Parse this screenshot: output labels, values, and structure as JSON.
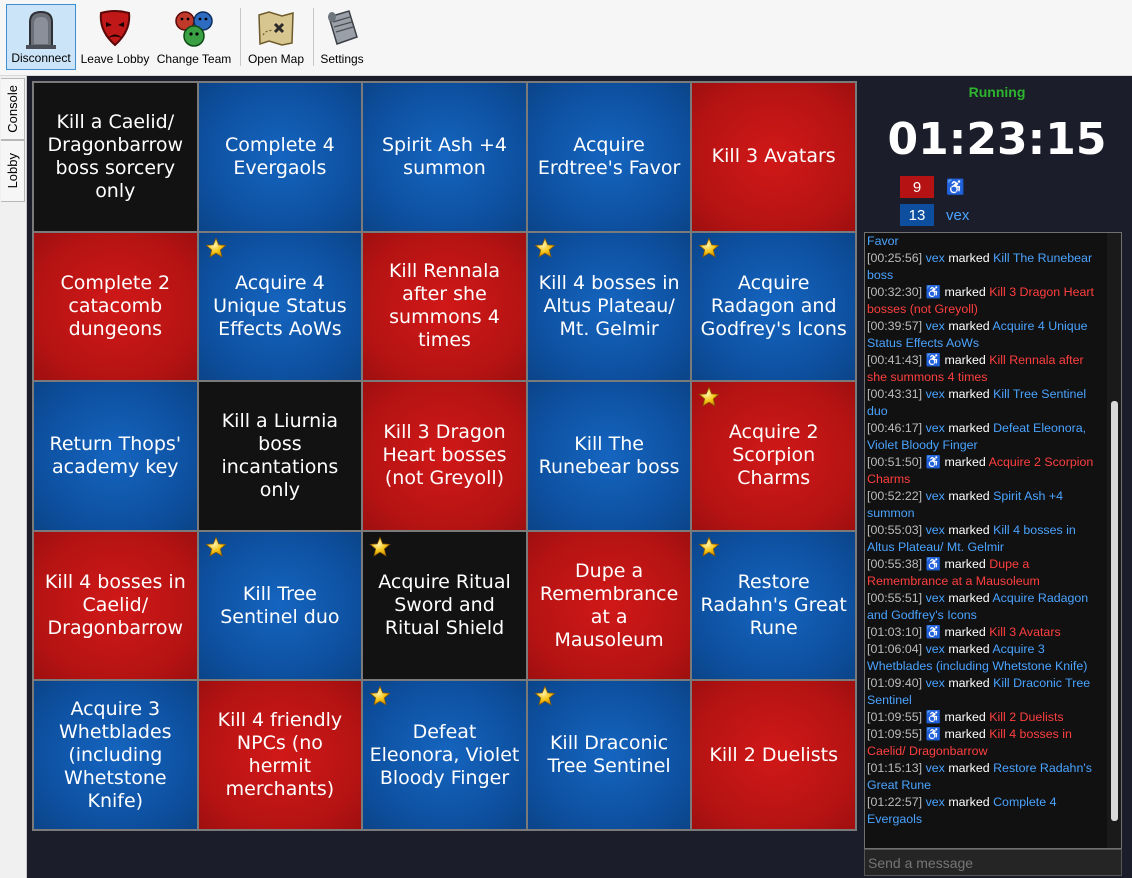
{
  "toolbar": {
    "disconnect": "Disconnect",
    "leave_lobby": "Leave Lobby",
    "change_team": "Change Team",
    "open_map": "Open Map",
    "settings": "Settings"
  },
  "side_tabs": {
    "console": "Console",
    "lobby": "Lobby"
  },
  "colors": {
    "blue_team": "#0d4f9e",
    "red_team": "#b51313",
    "unmarked": "#121212",
    "running": "#2db52d"
  },
  "board": {
    "cells": [
      {
        "text": "Kill a Caelid/ Dragonbarrow boss sorcery only",
        "state": "black",
        "star": false
      },
      {
        "text": "Complete 4 Evergaols",
        "state": "blue",
        "star": false
      },
      {
        "text": "Spirit Ash +4 summon",
        "state": "blue",
        "star": false
      },
      {
        "text": "Acquire Erdtree's Favor",
        "state": "blue",
        "star": false
      },
      {
        "text": "Kill 3 Avatars",
        "state": "red",
        "star": false
      },
      {
        "text": "Complete 2 catacomb dungeons",
        "state": "red",
        "star": false
      },
      {
        "text": "Acquire 4 Unique Status Effects AoWs",
        "state": "blue",
        "star": true
      },
      {
        "text": "Kill Rennala after she summons 4 times",
        "state": "red",
        "star": false
      },
      {
        "text": "Kill 4 bosses in Altus Plateau/ Mt. Gelmir",
        "state": "blue",
        "star": true
      },
      {
        "text": "Acquire Radagon and Godfrey's Icons",
        "state": "blue",
        "star": true
      },
      {
        "text": "Return Thops' academy key",
        "state": "blue",
        "star": false
      },
      {
        "text": "Kill a Liurnia boss incantations only",
        "state": "black",
        "star": false
      },
      {
        "text": "Kill 3 Dragon Heart bosses (not Greyoll)",
        "state": "red",
        "star": false
      },
      {
        "text": "Kill The Runebear boss",
        "state": "blue",
        "star": false
      },
      {
        "text": "Acquire 2 Scorpion Charms",
        "state": "red",
        "star": true
      },
      {
        "text": "Kill 4 bosses in Caelid/ Dragonbarrow",
        "state": "red",
        "star": false
      },
      {
        "text": "Kill Tree Sentinel duo",
        "state": "blue",
        "star": true
      },
      {
        "text": "Acquire Ritual Sword and Ritual Shield",
        "state": "black",
        "star": true
      },
      {
        "text": "Dupe a Remembrance at a Mausoleum",
        "state": "red",
        "star": false
      },
      {
        "text": "Restore Radahn's Great Rune",
        "state": "blue",
        "star": true
      },
      {
        "text": "Acquire 3 Whetblades (including Whetstone Knife)",
        "state": "blue",
        "star": false
      },
      {
        "text": "Kill 4 friendly NPCs (no hermit merchants)",
        "state": "red",
        "star": false
      },
      {
        "text": "Defeat Eleonora, Violet Bloody Finger",
        "state": "blue",
        "star": true
      },
      {
        "text": "Kill Draconic Tree Sentinel",
        "state": "blue",
        "star": true
      },
      {
        "text": "Kill 2 Duelists",
        "state": "red",
        "star": false
      }
    ]
  },
  "status": {
    "state": "Running",
    "timer": "01:23:15",
    "teams": [
      {
        "score": "9",
        "name": "♿",
        "color": "#b51313",
        "name_color": "#ff3f3f",
        "icon": "wheelchair-icon"
      },
      {
        "score": "13",
        "name": "vex",
        "color": "#0d4f9e",
        "name_color": "#4aa3ff"
      }
    ]
  },
  "log": {
    "word_marked": "marked",
    "head": "Favor",
    "entries": [
      {
        "t": "[00:25:56]",
        "p": "vex",
        "team": "blue",
        "g": "Kill The Runebear boss"
      },
      {
        "t": "[00:32:30]",
        "p": "♿",
        "team": "red",
        "g": "Kill 3 Dragon Heart bosses (not Greyoll)"
      },
      {
        "t": "[00:39:57]",
        "p": "vex",
        "team": "blue",
        "g": "Acquire 4 Unique Status Effects AoWs"
      },
      {
        "t": "[00:41:43]",
        "p": "♿",
        "team": "red",
        "g": "Kill Rennala after she summons 4 times"
      },
      {
        "t": "[00:43:31]",
        "p": "vex",
        "team": "blue",
        "g": "Kill Tree Sentinel duo"
      },
      {
        "t": "[00:46:17]",
        "p": "vex",
        "team": "blue",
        "g": "Defeat Eleonora, Violet Bloody Finger"
      },
      {
        "t": "[00:51:50]",
        "p": "♿",
        "team": "red",
        "g": "Acquire 2 Scorpion Charms"
      },
      {
        "t": "[00:52:22]",
        "p": "vex",
        "team": "blue",
        "g": "Spirit Ash +4 summon"
      },
      {
        "t": "[00:55:03]",
        "p": "vex",
        "team": "blue",
        "g": "Kill 4 bosses in Altus Plateau/ Mt. Gelmir"
      },
      {
        "t": "[00:55:38]",
        "p": "♿",
        "team": "red",
        "g": "Dupe a Remembrance at a Mausoleum"
      },
      {
        "t": "[00:55:51]",
        "p": "vex",
        "team": "blue",
        "g": "Acquire Radagon and Godfrey's Icons"
      },
      {
        "t": "[01:03:10]",
        "p": "♿",
        "team": "red",
        "g": "Kill 3 Avatars"
      },
      {
        "t": "[01:06:04]",
        "p": "vex",
        "team": "blue",
        "g": "Acquire 3 Whetblades (including Whetstone Knife)"
      },
      {
        "t": "[01:09:40]",
        "p": "vex",
        "team": "blue",
        "g": "Kill Draconic Tree Sentinel"
      },
      {
        "t": "[01:09:55]",
        "p": "♿",
        "team": "red",
        "g": "Kill 2 Duelists"
      },
      {
        "t": "[01:09:55]",
        "p": "♿",
        "team": "red",
        "g": "Kill 4 bosses in Caelid/ Dragonbarrow"
      },
      {
        "t": "[01:15:13]",
        "p": "vex",
        "team": "blue",
        "g": "Restore Radahn's Great Rune"
      },
      {
        "t": "[01:22:57]",
        "p": "vex",
        "team": "blue",
        "g": "Complete 4 Evergaols"
      }
    ]
  },
  "message": {
    "placeholder": "Send a message"
  }
}
